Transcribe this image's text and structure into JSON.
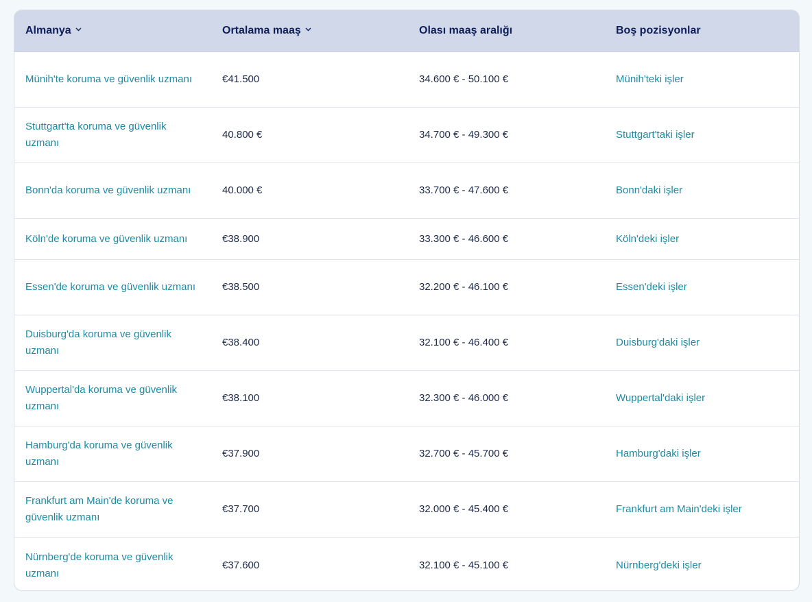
{
  "header": {
    "col1": "Almanya",
    "col2": "Ortalama maaş",
    "col3": "Olası maaş aralığı",
    "col4": "Boş pozisyonlar"
  },
  "rows": [
    {
      "job": "Münih'te koruma ve güvenlik uzmanı",
      "avg": "€41.500",
      "range": "34.600 € - 50.100 €",
      "jobs": "Münih'teki işler"
    },
    {
      "job": "Stuttgart'ta koruma ve güvenlik uzmanı",
      "avg": "40.800 €",
      "range": "34.700 € - 49.300 €",
      "jobs": "Stuttgart'taki işler"
    },
    {
      "job": "Bonn'da koruma ve güvenlik uzmanı",
      "avg": "40.000 €",
      "range": "33.700 € - 47.600 €",
      "jobs": "Bonn'daki işler"
    },
    {
      "job": "Köln'de koruma ve güvenlik uzmanı",
      "avg": "€38.900",
      "range": "33.300 € - 46.600 €",
      "jobs": "Köln'deki işler"
    },
    {
      "job": "Essen'de koruma ve güvenlik uzmanı",
      "avg": "€38.500",
      "range": "32.200 € - 46.100 €",
      "jobs": "Essen'deki işler"
    },
    {
      "job": "Duisburg'da koruma ve güvenlik uzmanı",
      "avg": "€38.400",
      "range": "32.100 € - 46.400 €",
      "jobs": "Duisburg'daki işler"
    },
    {
      "job": "Wuppertal'da koruma ve güvenlik uzmanı",
      "avg": "€38.100",
      "range": "32.300 € - 46.000 €",
      "jobs": "Wuppertal'daki işler"
    },
    {
      "job": "Hamburg'da koruma ve güvenlik uzmanı",
      "avg": "€37.900",
      "range": "32.700 € - 45.700 €",
      "jobs": "Hamburg'daki işler"
    },
    {
      "job": "Frankfurt am Main'de koruma ve güvenlik uzmanı",
      "avg": "€37.700",
      "range": "32.000 € - 45.400 €",
      "jobs": "Frankfurt am Main'deki işler"
    },
    {
      "job": "Nürnberg'de koruma ve güvenlik uzmanı",
      "avg": "€37.600",
      "range": "32.100 € - 45.100 €",
      "jobs": "Nürnberg'deki işler"
    }
  ],
  "colors": {
    "header_bg": "#d1d8e9",
    "header_text": "#0f1e5c",
    "link": "#1f8aa3",
    "body_text": "#1e2a4a"
  }
}
